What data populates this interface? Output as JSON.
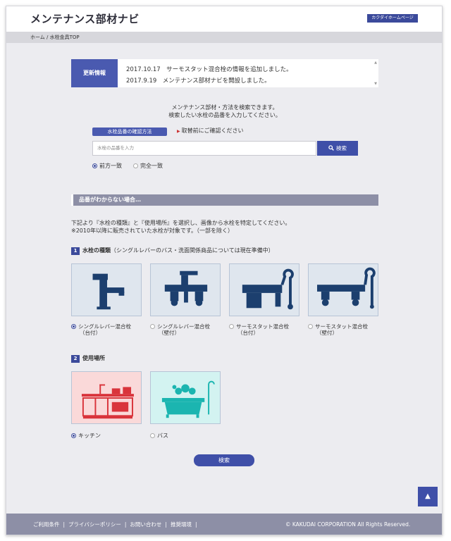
{
  "header": {
    "site_title": "メンテナンス部材ナビ",
    "home_link": "カクダイホームページ"
  },
  "breadcrumb": {
    "home": "ホーム",
    "separator": "/",
    "current": "水栓金具TOP"
  },
  "news": {
    "label": "更新情報",
    "items": [
      "2017.10.17　サーモスタット混合栓の情報を追加しました。",
      "2017.9.19　メンテナンス部材ナビを開設しました。"
    ]
  },
  "search": {
    "intro_line1": "メンテナンス部材・方法を検索できます。",
    "intro_line2": "検索したい水栓の品番を入力してください。",
    "howto_label": "水栓品番の確認方法",
    "check_note": "取替前にご確認ください",
    "placeholder": "水栓の品番を入力",
    "button_label": "検索",
    "match_options": [
      {
        "label": "前方一致",
        "selected": true
      },
      {
        "label": "完全一致",
        "selected": false
      }
    ]
  },
  "unknown_section": {
    "title": "品番がわからない場合…",
    "desc_line1": "下記より『水栓の種類』と『使用場所』を選択し、画像から水栓を特定してください。",
    "desc_line2": "※2010年以降に販売されていた水栓が対象です。（一部を除く）"
  },
  "step1": {
    "num": "1",
    "title": "水栓の種類",
    "note": "（シングルレバーのバス・洗面関係商品については現在準備中）",
    "options": [
      {
        "label": "シングルレバー混合栓",
        "sub": "（台付）",
        "selected": true,
        "icon": "single-lever-deck-faucet-icon"
      },
      {
        "label": "シングルレバー混合栓",
        "sub": "（壁付）",
        "selected": false,
        "icon": "single-lever-wall-faucet-icon"
      },
      {
        "label": "サーモスタット混合栓",
        "sub": "（台付）",
        "selected": false,
        "icon": "thermostat-deck-faucet-icon"
      },
      {
        "label": "サーモスタット混合栓",
        "sub": "（壁付）",
        "selected": false,
        "icon": "thermostat-wall-faucet-icon"
      }
    ]
  },
  "step2": {
    "num": "2",
    "title": "使用場所",
    "options": [
      {
        "label": "キッチン",
        "selected": true,
        "icon": "kitchen-icon"
      },
      {
        "label": "バス",
        "selected": false,
        "icon": "bathtub-icon"
      }
    ]
  },
  "submit_label": "検索",
  "to_top_icon": "arrow-up-icon",
  "footer": {
    "links": [
      "ご利用条件",
      "プライバシーポリシー",
      "お問い合わせ",
      "推奨環境"
    ],
    "separator": "|",
    "copyright": "© KAKUDAI CORPORATION All Rights Reserved."
  },
  "colors": {
    "accent": "#3f4fa8",
    "footer_bg": "#8d8fa6",
    "kitchen_card": "#fad9d9",
    "bath_card": "#d3f3f1",
    "faucet_card": "#dfe6ee"
  }
}
